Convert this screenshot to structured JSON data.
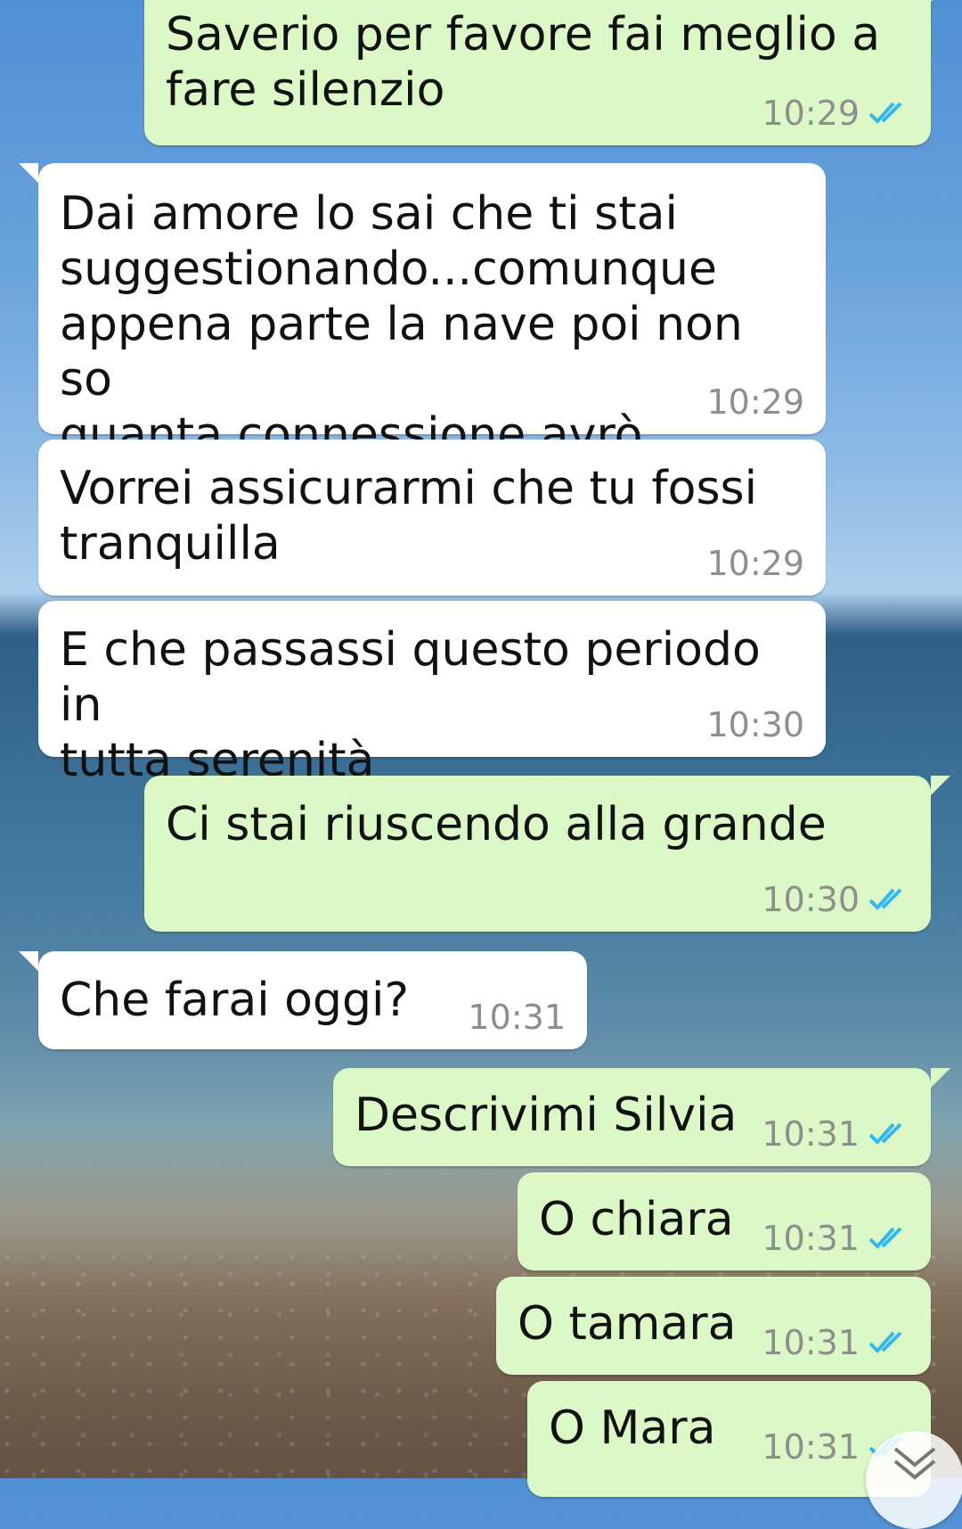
{
  "messages": [
    {
      "text": "Saverio per favore fai meglio a\nfare silenzio",
      "time": "10:29",
      "direction": "out",
      "status": "read"
    },
    {
      "text": "Dai amore lo sai che ti stai\nsuggestionando...comunque\nappena parte la nave poi non so\nquanta connessione avrò",
      "time": "10:29",
      "direction": "in"
    },
    {
      "text": "Vorrei assicurarmi che tu fossi\ntranquilla",
      "time": "10:29",
      "direction": "in"
    },
    {
      "text": "E che passassi questo periodo in\ntutta serenità",
      "time": "10:30",
      "direction": "in"
    },
    {
      "text": "Ci stai riuscendo alla grande",
      "time": "10:30",
      "direction": "out",
      "status": "read"
    },
    {
      "text": "Che farai oggi?",
      "time": "10:31",
      "direction": "in"
    },
    {
      "text": "Descrivimi Silvia",
      "time": "10:31",
      "direction": "out",
      "status": "read"
    },
    {
      "text": "O chiara",
      "time": "10:31",
      "direction": "out",
      "status": "read"
    },
    {
      "text": "O tamara",
      "time": "10:31",
      "direction": "out",
      "status": "read"
    },
    {
      "text": "O Mara",
      "time": "10:31",
      "direction": "out",
      "status": "read"
    }
  ],
  "icons": {
    "read_receipt": "double-check-icon",
    "scroll_down": "chevron-double-down-icon"
  },
  "colors": {
    "incoming_bubble": "#ffffff",
    "outgoing_bubble": "#dcf8c6",
    "read_tick": "#34b7f1",
    "timestamp": "#8e8e8e"
  }
}
